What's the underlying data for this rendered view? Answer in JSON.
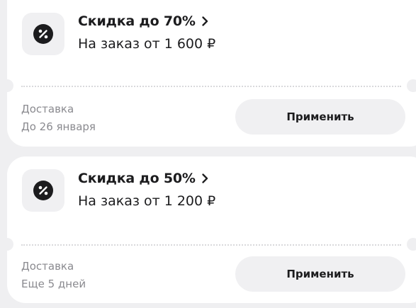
{
  "coupons": [
    {
      "title": "Скидка до 70%",
      "condition": "На заказ от 1 600 ₽",
      "meta_label": "Доставка",
      "meta_value": "До 26 января",
      "button_label": "Применить",
      "icon": "percent-badge-icon"
    },
    {
      "title": "Скидка до 50%",
      "condition": "На заказ от 1 200 ₽",
      "meta_label": "Доставка",
      "meta_value": "Еще 5 дней",
      "button_label": "Применить",
      "icon": "percent-badge-icon"
    }
  ],
  "colors": {
    "page_background": "#efeff1",
    "card_background": "#ffffff",
    "icon_background": "#f0f0f2",
    "icon_fill": "#1c1c1e",
    "button_background": "#f0f0f2",
    "secondary_text": "#8a8a8f"
  }
}
